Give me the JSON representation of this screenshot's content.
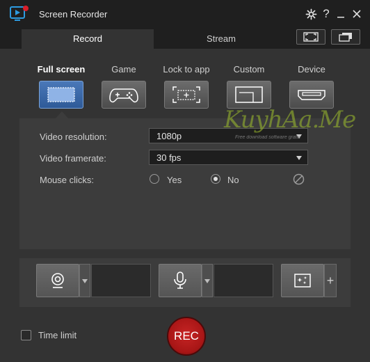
{
  "window": {
    "title": "Screen Recorder"
  },
  "tabs": [
    {
      "label": "Record",
      "active": true
    },
    {
      "label": "Stream",
      "active": false
    }
  ],
  "modes": [
    {
      "label": "Full screen",
      "icon": "full-screen-icon",
      "selected": true
    },
    {
      "label": "Game",
      "icon": "gamepad-icon",
      "selected": false
    },
    {
      "label": "Lock to app",
      "icon": "lock-to-app-icon",
      "selected": false
    },
    {
      "label": "Custom",
      "icon": "custom-region-icon",
      "selected": false
    },
    {
      "label": "Device",
      "icon": "hdmi-device-icon",
      "selected": false
    }
  ],
  "settings": {
    "resolution_label": "Video resolution:",
    "resolution_value": "1080p",
    "framerate_label": "Video framerate:",
    "framerate_value": "30 fps",
    "mouse_label": "Mouse clicks:",
    "mouse_yes": "Yes",
    "mouse_no": "No",
    "mouse_selected": "No"
  },
  "bottom": {
    "time_limit_label": "Time limit",
    "time_limit_checked": false,
    "rec_label": "REC"
  },
  "watermark": {
    "text": "KuyhAa.Me",
    "subtext": "Free download software gratis"
  },
  "colors": {
    "accent": "#3a6db0",
    "rec": "#b51c1c",
    "background": "#333333"
  }
}
